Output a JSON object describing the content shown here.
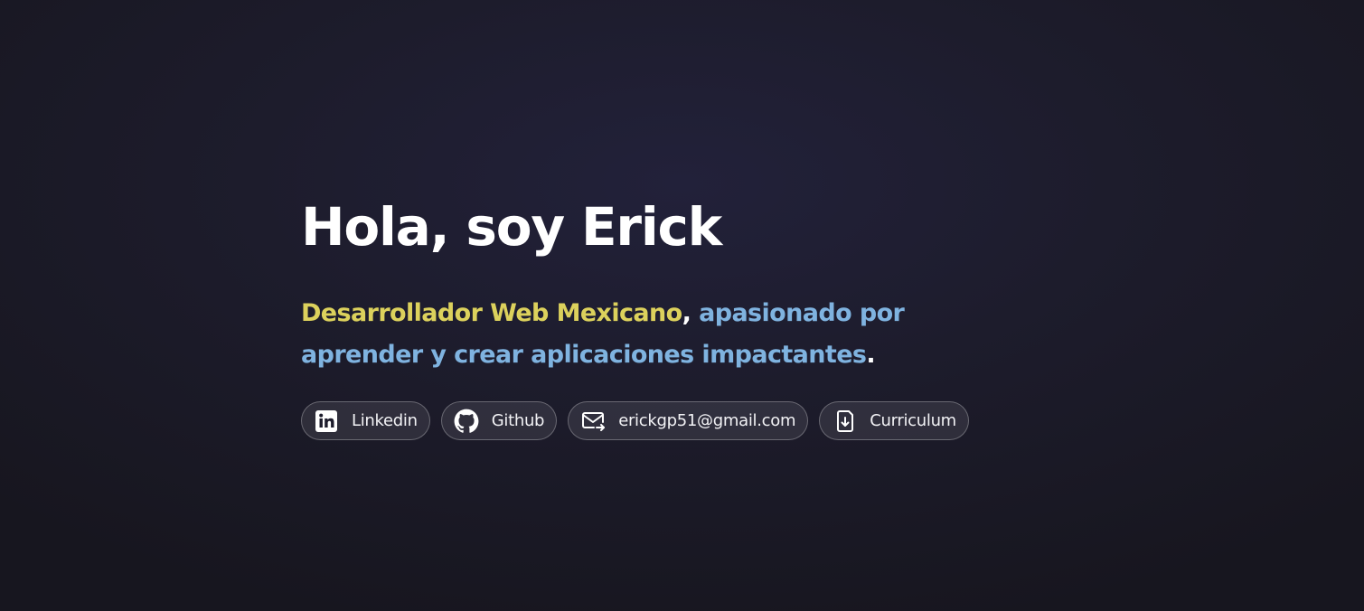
{
  "hero": {
    "title": "Hola, soy Erick",
    "tagline": {
      "part1": "Desarrollador Web Mexicano",
      "part2": ", ",
      "part3": "apasionado por aprender y crear aplicaciones impactantes",
      "part4": "."
    },
    "colors": {
      "highlight_yellow": "#dcd15c",
      "highlight_blue": "#7fb3e0",
      "background": "#1d1c2c"
    }
  },
  "links": [
    {
      "label": "Linkedin",
      "icon": "linkedin-icon"
    },
    {
      "label": "Github",
      "icon": "github-icon"
    },
    {
      "label": "erickgp51@gmail.com",
      "icon": "mail-icon"
    },
    {
      "label": "Curriculum",
      "icon": "file-download-icon"
    }
  ]
}
